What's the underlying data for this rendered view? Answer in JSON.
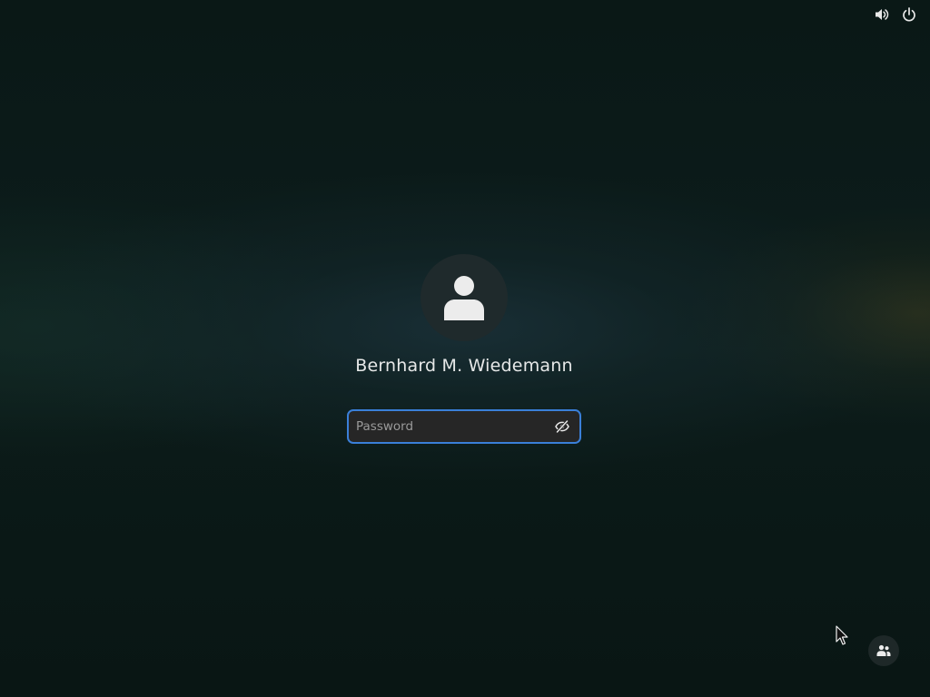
{
  "topbar": {
    "volume_icon": "volume-high-icon",
    "power_icon": "power-icon"
  },
  "login": {
    "avatar_icon": "user-avatar-icon",
    "user_name": "Bernhard M. Wiedemann",
    "password": {
      "placeholder": "Password",
      "value": "",
      "reveal_icon": "eye-hidden-icon"
    }
  },
  "bottom_right": {
    "users_icon": "users-icon"
  },
  "colors": {
    "accent": "#3a7fd8",
    "text": "#e6e8e8",
    "input_bg": "#262626",
    "avatar_bg": "#1f2a2c"
  }
}
